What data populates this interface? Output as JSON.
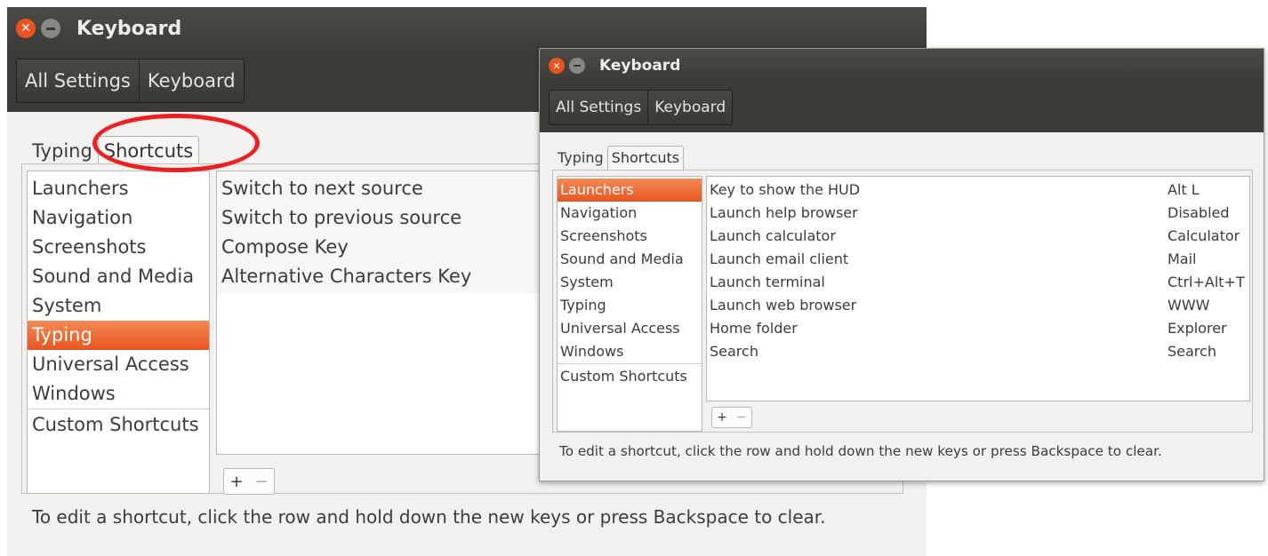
{
  "back_window": {
    "title": "Keyboard",
    "breadcrumbs": [
      "All Settings",
      "Keyboard"
    ],
    "tabs": [
      "Typing",
      "Shortcuts"
    ],
    "active_tab": "Shortcuts",
    "categories": [
      "Launchers",
      "Navigation",
      "Screenshots",
      "Sound and Media",
      "System",
      "Typing",
      "Universal Access",
      "Windows"
    ],
    "custom_category": "Custom Shortcuts",
    "selected_category": "Typing",
    "shortcuts": [
      {
        "action": "Switch to next source",
        "key": ""
      },
      {
        "action": "Switch to previous source",
        "key": ""
      },
      {
        "action": "Compose Key",
        "key": ""
      },
      {
        "action": "Alternative Characters Key",
        "key": ""
      }
    ],
    "add_label": "+",
    "remove_label": "−",
    "hint": "To edit a shortcut, click the row and hold down the new keys or press Backspace to clear."
  },
  "front_window": {
    "title": "Keyboard",
    "breadcrumbs": [
      "All Settings",
      "Keyboard"
    ],
    "tabs": [
      "Typing",
      "Shortcuts"
    ],
    "active_tab": "Shortcuts",
    "categories": [
      "Launchers",
      "Navigation",
      "Screenshots",
      "Sound and Media",
      "System",
      "Typing",
      "Universal Access",
      "Windows"
    ],
    "custom_category": "Custom Shortcuts",
    "selected_category": "Launchers",
    "shortcuts": [
      {
        "action": "Key to show the HUD",
        "key": "Alt L"
      },
      {
        "action": "Launch help browser",
        "key": "Disabled"
      },
      {
        "action": "Launch calculator",
        "key": "Calculator"
      },
      {
        "action": "Launch email client",
        "key": "Mail"
      },
      {
        "action": "Launch terminal",
        "key": "Ctrl+Alt+T"
      },
      {
        "action": "Launch web browser",
        "key": "WWW"
      },
      {
        "action": "Home folder",
        "key": "Explorer"
      },
      {
        "action": "Search",
        "key": "Search"
      }
    ],
    "add_label": "+",
    "remove_label": "−",
    "hint": "To edit a shortcut, click the row and hold down the new keys or press Backspace to clear."
  },
  "annotation": {
    "highlighted": "Shortcuts",
    "color": "#ee1f23"
  },
  "colors": {
    "accent": "#e95420",
    "titlebar": "#3c3b37",
    "window_bg": "#f2f1f0"
  }
}
